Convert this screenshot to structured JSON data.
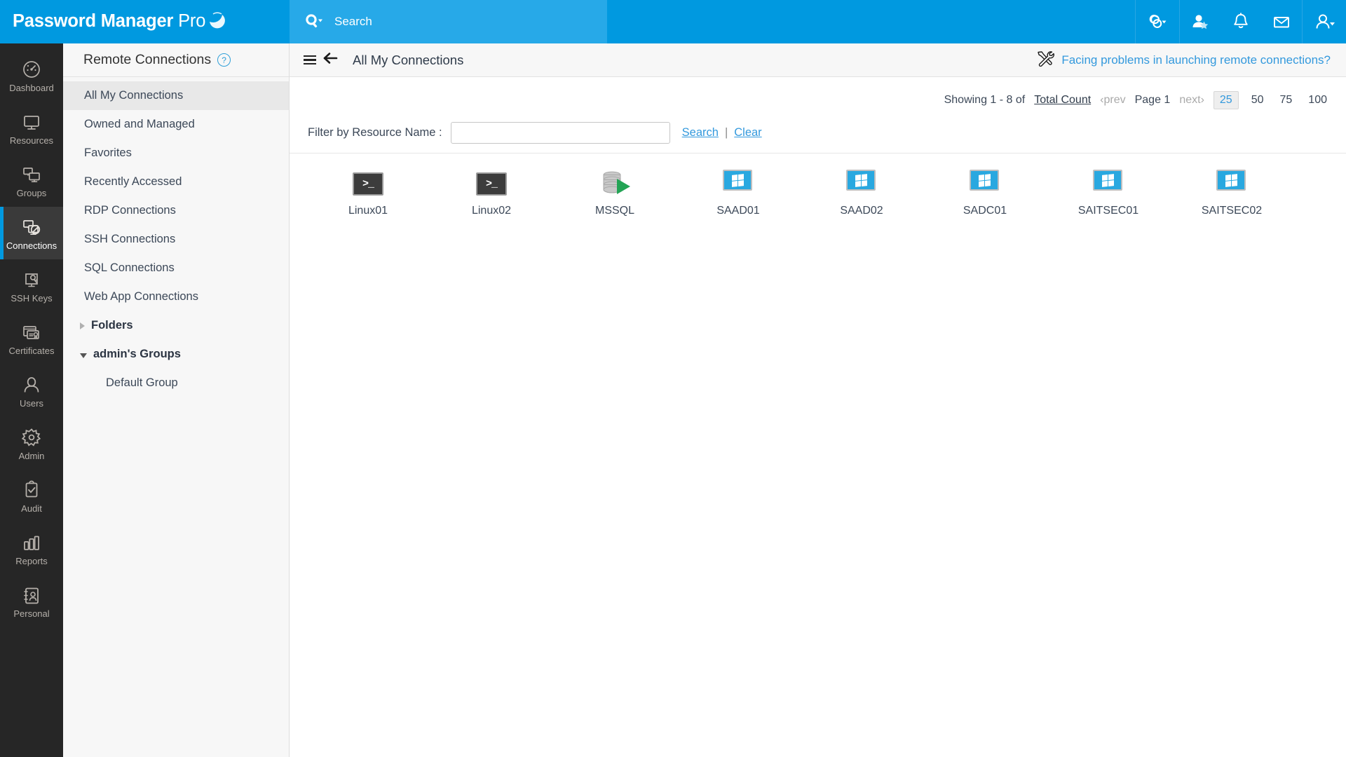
{
  "brand": {
    "name_bold": "Password Manager",
    "name_thin": " Pro"
  },
  "search": {
    "placeholder": "Search",
    "icon": "search-dropdown-icon"
  },
  "topbar": {
    "icons": [
      {
        "name": "link-dropdown-icon",
        "title": "Quick Connect"
      },
      {
        "name": "user-star-icon",
        "title": "Favorites"
      },
      {
        "name": "bell-icon",
        "title": "Notifications"
      },
      {
        "name": "envelope-icon",
        "title": "Mail"
      },
      {
        "name": "user-account-icon",
        "title": "Account"
      }
    ],
    "accent": "#0099e0",
    "search_bg": "#27a9e8"
  },
  "rail": {
    "items": [
      {
        "label": "Dashboard",
        "icon": "gauge-icon",
        "active": false
      },
      {
        "label": "Resources",
        "icon": "monitor-icon",
        "active": false
      },
      {
        "label": "Groups",
        "icon": "monitors-group-icon",
        "active": false
      },
      {
        "label": "Connections",
        "icon": "remote-connection-icon",
        "active": true
      },
      {
        "label": "SSH Keys",
        "icon": "ssh-key-icon",
        "active": false
      },
      {
        "label": "Certificates",
        "icon": "certificate-icon",
        "active": false
      },
      {
        "label": "Users",
        "icon": "user-icon",
        "active": false
      },
      {
        "label": "Admin",
        "icon": "gear-icon",
        "active": false
      },
      {
        "label": "Audit",
        "icon": "clipboard-check-icon",
        "active": false
      },
      {
        "label": "Reports",
        "icon": "bar-chart-icon",
        "active": false
      },
      {
        "label": "Personal",
        "icon": "personal-card-icon",
        "active": false
      }
    ]
  },
  "panel": {
    "title": "Remote Connections",
    "help_badge": "?",
    "items": [
      {
        "label": "All My Connections",
        "selected": true
      },
      {
        "label": "Owned and Managed",
        "selected": false
      },
      {
        "label": "Favorites",
        "selected": false
      },
      {
        "label": "Recently Accessed",
        "selected": false
      },
      {
        "label": "RDP Connections",
        "selected": false
      },
      {
        "label": "SSH Connections",
        "selected": false
      },
      {
        "label": "SQL Connections",
        "selected": false
      },
      {
        "label": "Web App Connections",
        "selected": false
      }
    ],
    "tree": [
      {
        "label": "Folders",
        "expanded": false,
        "children": []
      },
      {
        "label": "admin's Groups",
        "expanded": true,
        "children": [
          {
            "label": "Default Group"
          }
        ]
      }
    ]
  },
  "main": {
    "breadcrumb_title": "All My Connections",
    "menu_icon": "hamburger-icon",
    "back_icon": "arrow-left-icon",
    "help_link": {
      "text": "Facing problems in launching remote connections?",
      "icon": "tools-icon",
      "color": "#3399dd"
    }
  },
  "pagination": {
    "showing": "Showing 1 - 8 of",
    "total_count_label": "Total Count",
    "prev_label": "prev",
    "page_label": "Page 1",
    "next_label": "next",
    "page_sizes": [
      "25",
      "50",
      "75",
      "100"
    ],
    "active_page_size": "25"
  },
  "filter": {
    "label": "Filter by Resource Name :",
    "value": "",
    "placeholder": "",
    "search_label": "Search",
    "separator": "|",
    "clear_label": "Clear"
  },
  "connections": [
    {
      "label": "Linux01",
      "type": "terminal",
      "glyph": ">_"
    },
    {
      "label": "Linux02",
      "type": "terminal",
      "glyph": ">_"
    },
    {
      "label": "MSSQL",
      "type": "database",
      "glyph": ""
    },
    {
      "label": "SAAD01",
      "type": "windows",
      "glyph": ""
    },
    {
      "label": "SAAD02",
      "type": "windows",
      "glyph": ""
    },
    {
      "label": "SADC01",
      "type": "windows",
      "glyph": ""
    },
    {
      "label": "SAITSEC01",
      "type": "windows",
      "glyph": ""
    },
    {
      "label": "SAITSEC02",
      "type": "windows",
      "glyph": ""
    }
  ]
}
